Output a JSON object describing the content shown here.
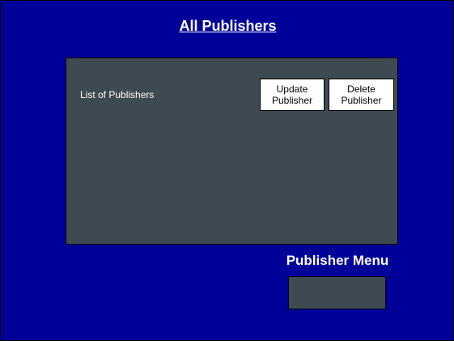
{
  "page": {
    "title": "All Publishers"
  },
  "list_panel": {
    "label": "List of Publishers",
    "buttons": {
      "update": "Update\nPublisher",
      "delete": "Delete\nPublisher"
    }
  },
  "publisher_menu": {
    "title": "Publisher Menu"
  },
  "colors": {
    "background": "#000099",
    "panel": "#3e4a52",
    "button_bg": "#ffffff",
    "text": "#ffffff"
  }
}
